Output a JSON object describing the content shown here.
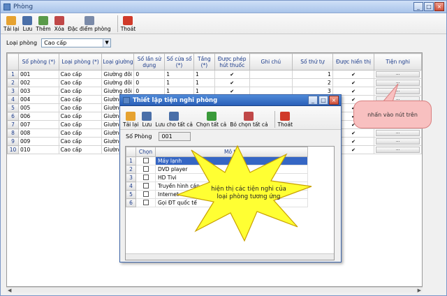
{
  "window": {
    "title": "Phòng",
    "buttons": [
      "_",
      "□",
      "×"
    ]
  },
  "toolbar": [
    {
      "label": "Tải lại",
      "icon": "refresh-icon",
      "color": "#e6a230"
    },
    {
      "label": "Lưu",
      "icon": "save-icon",
      "color": "#4a6fa8"
    },
    {
      "label": "Thêm",
      "icon": "add-icon",
      "color": "#5a9a4a"
    },
    {
      "label": "Xóa",
      "icon": "delete-icon",
      "color": "#c04848"
    },
    {
      "label": "Đặc điểm phòng",
      "icon": "search-icon",
      "color": "#7a8aa8"
    },
    {
      "label": "Thoát",
      "icon": "exit-icon",
      "color": "#d03a2a"
    }
  ],
  "filter": {
    "label": "Loại phòng",
    "value": "Cao cấp"
  },
  "grid": {
    "columns": [
      "Số phòng (*)",
      "Loại phòng (*)",
      "Loại giường",
      "Số lần sử dụng",
      "Số cửa sổ (*)",
      "Tầng (*)",
      "Được phép hút thuốc",
      "Ghi chú",
      "Số thứ tự",
      "Được hiển thị",
      "Tiện nghi"
    ],
    "rows": [
      {
        "n": "1",
        "so_phong": "001",
        "loai_phong": "Cao cấp",
        "loai_giuong": "Giường đôi",
        "su_dung": "0",
        "cua_so": "1",
        "tang": "1",
        "thuoc": "✔",
        "ghi_chu": "",
        "stt": "1",
        "hien_thi": "✔",
        "tien_nghi": "..."
      },
      {
        "n": "2",
        "so_phong": "002",
        "loai_phong": "Cao cấp",
        "loai_giuong": "Giường đôi",
        "su_dung": "0",
        "cua_so": "1",
        "tang": "1",
        "thuoc": "✔",
        "ghi_chu": "",
        "stt": "2",
        "hien_thi": "✔",
        "tien_nghi": "..."
      },
      {
        "n": "3",
        "so_phong": "003",
        "loai_phong": "Cao cấp",
        "loai_giuong": "Giường đôi",
        "su_dung": "0",
        "cua_so": "1",
        "tang": "1",
        "thuoc": "✔",
        "ghi_chu": "",
        "stt": "3",
        "hien_thi": "✔",
        "tien_nghi": "..."
      },
      {
        "n": "4",
        "so_phong": "004",
        "loai_phong": "Cao cấp",
        "loai_giuong": "Giường",
        "su_dung": "",
        "cua_so": "",
        "tang": "",
        "thuoc": "",
        "ghi_chu": "",
        "stt": "",
        "hien_thi": "✔",
        "tien_nghi": "..."
      },
      {
        "n": "5",
        "so_phong": "005",
        "loai_phong": "Cao cấp",
        "loai_giuong": "Giường",
        "su_dung": "",
        "cua_so": "",
        "tang": "",
        "thuoc": "",
        "ghi_chu": "",
        "stt": "",
        "hien_thi": "✔",
        "tien_nghi": "..."
      },
      {
        "n": "6",
        "so_phong": "006",
        "loai_phong": "Cao cấp",
        "loai_giuong": "Giường",
        "su_dung": "",
        "cua_so": "",
        "tang": "",
        "thuoc": "",
        "ghi_chu": "",
        "stt": "",
        "hien_thi": "✔",
        "tien_nghi": "..."
      },
      {
        "n": "7",
        "so_phong": "007",
        "loai_phong": "Cao cấp",
        "loai_giuong": "Giường",
        "su_dung": "",
        "cua_so": "",
        "tang": "",
        "thuoc": "",
        "ghi_chu": "",
        "stt": "",
        "hien_thi": "✔",
        "tien_nghi": "..."
      },
      {
        "n": "8",
        "so_phong": "008",
        "loai_phong": "Cao cấp",
        "loai_giuong": "Giường",
        "su_dung": "",
        "cua_so": "",
        "tang": "",
        "thuoc": "",
        "ghi_chu": "",
        "stt": "",
        "hien_thi": "✔",
        "tien_nghi": "..."
      },
      {
        "n": "9",
        "so_phong": "009",
        "loai_phong": "Cao cấp",
        "loai_giuong": "Giường",
        "su_dung": "",
        "cua_so": "",
        "tang": "",
        "thuoc": "",
        "ghi_chu": "",
        "stt": "",
        "hien_thi": "✔",
        "tien_nghi": "..."
      },
      {
        "n": "10",
        "so_phong": "010",
        "loai_phong": "Cao cấp",
        "loai_giuong": "Giường",
        "su_dung": "",
        "cua_so": "",
        "tang": "",
        "thuoc": "",
        "ghi_chu": "",
        "stt": "",
        "hien_thi": "✔",
        "tien_nghi": "..."
      }
    ]
  },
  "callout": {
    "text": "nhấn vào nút trên"
  },
  "dialog": {
    "title": "Thiết lập tiện nghi phòng",
    "toolbar": [
      {
        "label": "Tải lại",
        "icon": "refresh-icon",
        "color": "#e6a230"
      },
      {
        "label": "Lưu",
        "icon": "save-icon",
        "color": "#4a6fa8"
      },
      {
        "label": "Lưu cho tất cả",
        "icon": "save-all-icon",
        "color": "#4a6fa8"
      },
      {
        "label": "Chọn tất cả",
        "icon": "check-all-icon",
        "color": "#3a9a3a"
      },
      {
        "label": "Bỏ chọn tất cả",
        "icon": "uncheck-all-icon",
        "color": "#c04848"
      },
      {
        "label": "Thoát",
        "icon": "exit-icon",
        "color": "#d03a2a"
      }
    ],
    "field": {
      "label": "Số Phòng",
      "value": "001"
    },
    "columns": [
      "Chọn",
      "Mô tả"
    ],
    "rows": [
      {
        "n": "1",
        "desc": "Máy lạnh"
      },
      {
        "n": "2",
        "desc": "DVD player"
      },
      {
        "n": "3",
        "desc": "HD Tivi"
      },
      {
        "n": "4",
        "desc": "Truyền hình cáp"
      },
      {
        "n": "5",
        "desc": "Internet"
      },
      {
        "n": "6",
        "desc": "Gọi ĐT quốc tế"
      }
    ]
  },
  "annotation": {
    "text": "hiện thị các tiện nghi của loại phòng tương ứng"
  }
}
